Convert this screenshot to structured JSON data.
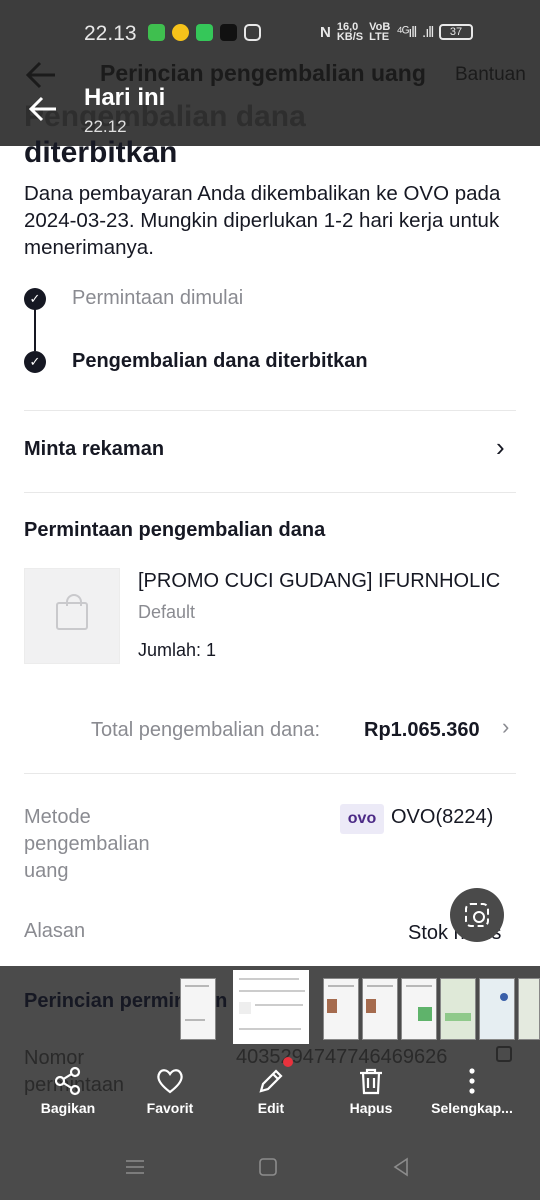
{
  "status_bar": {
    "time": "22.13",
    "speed": "16,0\nKB/S",
    "network": "4G",
    "battery": "37"
  },
  "header": {
    "title": "Perincian pengembalian uang",
    "help": "Bantuan"
  },
  "gallery": {
    "title": "Hari ini",
    "time": "22.12"
  },
  "refund": {
    "heading_top": "Pengembalian dana",
    "heading": "diterbitkan",
    "description": "Dana pembayaran Anda dikembalikan ke OVO pada 2024-03-23. Mungkin diperlukan 1-2 hari kerja untuk menerimanya.",
    "steps": [
      {
        "label": "Permintaan dimulai"
      },
      {
        "label": "Pengembalian dana diterbitkan"
      }
    ],
    "records_label": "Minta rekaman",
    "request_section_title": "Permintaan pengembalian dana",
    "product": {
      "name": "[PROMO CUCI GUDANG] IFURNHOLIC",
      "variant": "Default",
      "quantity": "Jumlah: 1"
    },
    "total_label": "Total pengembalian dana:",
    "total_value": "Rp1.065.360",
    "method_label": "Metode pengembalian uang",
    "method_logo": "ovo",
    "method_value": "OVO(8224)",
    "reason_label": "Alasan",
    "reason_value": "Stok habis",
    "details_title": "Perincian permintaan",
    "request_no_label": "Nomor permintaan",
    "request_no_value": "4035294747746469626"
  },
  "actions": [
    {
      "label": "Bagikan",
      "icon": "share-icon"
    },
    {
      "label": "Favorit",
      "icon": "heart-icon"
    },
    {
      "label": "Edit",
      "icon": "pencil-icon"
    },
    {
      "label": "Hapus",
      "icon": "trash-icon"
    },
    {
      "label": "Selengkap...",
      "icon": "more-icon"
    }
  ]
}
